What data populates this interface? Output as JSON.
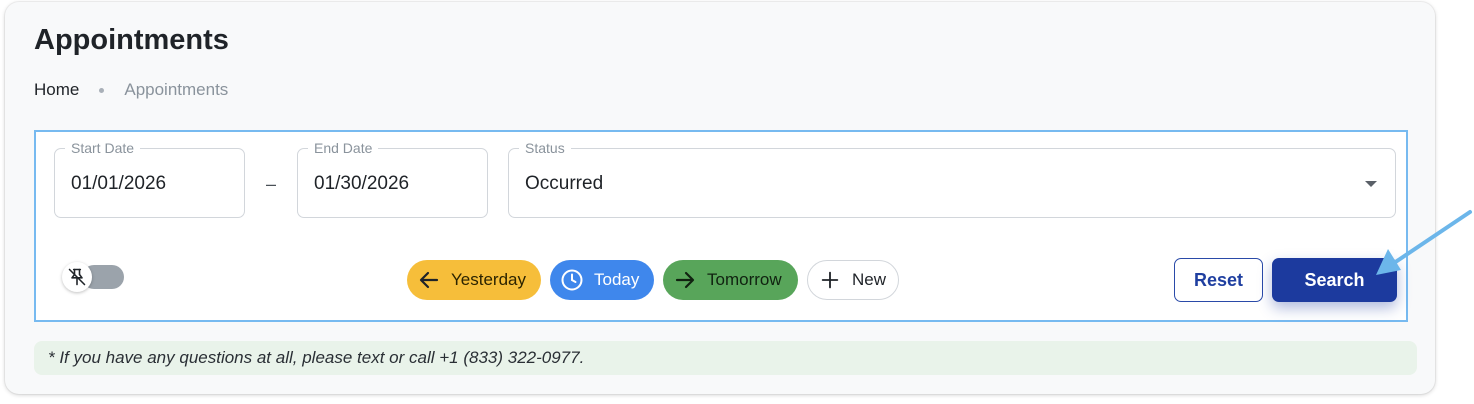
{
  "page": {
    "title": "Appointments"
  },
  "breadcrumb": {
    "home": "Home",
    "current": "Appointments"
  },
  "filters": {
    "start_date": {
      "label": "Start Date",
      "value": "01/01/2026"
    },
    "separator": "–",
    "end_date": {
      "label": "End Date",
      "value": "01/30/2026"
    },
    "status": {
      "label": "Status",
      "value": "Occurred"
    }
  },
  "quick_chips": {
    "yesterday": "Yesterday",
    "today": "Today",
    "tomorrow": "Tomorrow",
    "new": "New"
  },
  "actions": {
    "reset": "Reset",
    "search": "Search"
  },
  "pin_toggle": {
    "on": false,
    "icon": "pin-off-icon"
  },
  "note": "* If you have any questions at all, please text or call +1 (833) 322-0977.",
  "colors": {
    "filter_border": "#77baf0",
    "yesterday": "#f6be3a",
    "today": "#3f87ec",
    "tomorrow": "#58a55a",
    "search": "#1c3a9e",
    "note_bg": "#e9f3ea",
    "pointer_arrow": "#6cb6ea"
  }
}
